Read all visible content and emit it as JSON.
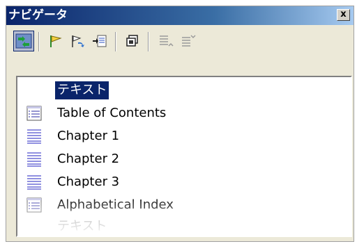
{
  "window": {
    "title": "ナビゲータ",
    "close_label": "x"
  },
  "toolbar": {
    "buttons": [
      {
        "name": "toggle-button",
        "icon": "navigator-toggle-icon"
      },
      {
        "name": "set-reminder-button",
        "icon": "flag-icon"
      },
      {
        "name": "go-to-reminder-button",
        "icon": "flag-arrow-icon"
      },
      {
        "name": "insert-button",
        "icon": "insert-arrow-icon"
      },
      {
        "name": "drag-mode-button",
        "icon": "drag-mode-icon"
      },
      {
        "name": "promote-level-button",
        "icon": "promote-level-icon"
      },
      {
        "name": "demote-level-button",
        "icon": "demote-level-icon"
      }
    ]
  },
  "tree": {
    "items": [
      {
        "label": "テキスト",
        "icon": "none",
        "state": "selected"
      },
      {
        "label": "Table of Contents",
        "icon": "table-of-contents-icon"
      },
      {
        "label": "Chapter 1",
        "icon": "chapter-icon"
      },
      {
        "label": "Chapter 2",
        "icon": "chapter-icon"
      },
      {
        "label": "Chapter 3",
        "icon": "chapter-icon"
      },
      {
        "label": "Alphabetical Index",
        "icon": "alphabetical-index-icon"
      },
      {
        "label": "テキスト",
        "icon": "none",
        "state": "disabled"
      }
    ]
  },
  "colors": {
    "title_bar": "#0a246a",
    "selection": "#0a246a",
    "chapter_lines": "#6b6bd6"
  }
}
